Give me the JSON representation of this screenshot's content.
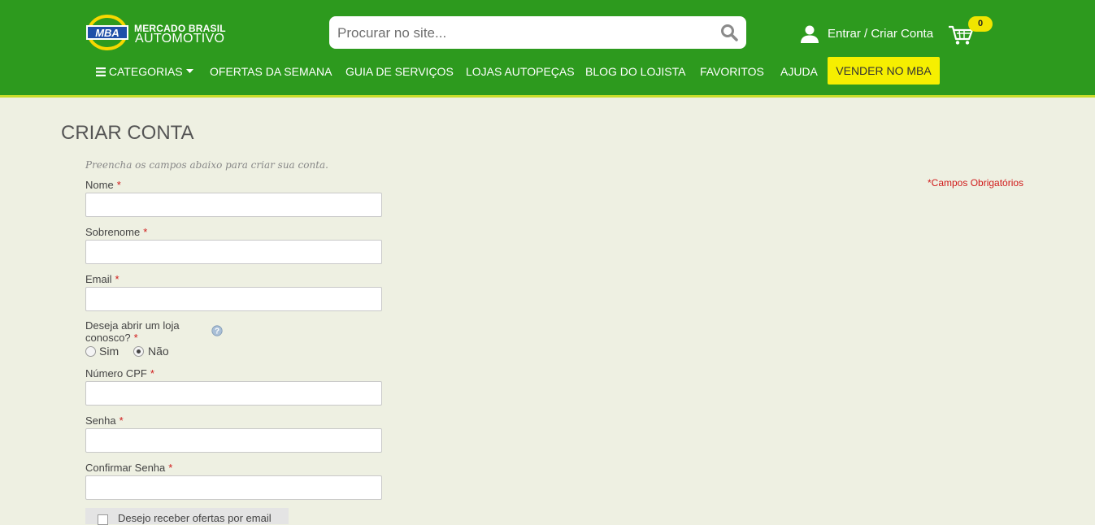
{
  "header": {
    "logo": {
      "line1": "MERCADO BRASIL",
      "line2": "AUTOMOTIVO",
      "badge_text": "MBA"
    },
    "search": {
      "placeholder": "Procurar no site...",
      "value": "",
      "icon": "search-icon"
    },
    "account": {
      "label": "Entrar / Criar Conta",
      "icon": "user-icon"
    },
    "cart": {
      "count": "0",
      "icon": "cart-icon"
    },
    "colors": {
      "bar": "#2d9a1e",
      "accent": "#f6ef00"
    }
  },
  "nav": {
    "categories": "CATEGORIAS",
    "items": [
      "OFERTAS DA SEMANA",
      "GUIA DE SERVIÇOS",
      "LOJAS AUTOPEÇAS",
      "BLOG DO LOJISTA",
      "FAVORITOS",
      "AJUDA"
    ],
    "cta": "VENDER NO MBA"
  },
  "page": {
    "title": "CRIAR CONTA",
    "intro": "Preencha os campos abaixo para criar sua conta.",
    "required_note": "*Campos Obrigatórios"
  },
  "form": {
    "required_mark": "*",
    "fields": [
      {
        "label": "Nome",
        "value": ""
      },
      {
        "label": "Sobrenome",
        "value": ""
      },
      {
        "label": "Email",
        "value": ""
      },
      {
        "label": "Número CPF",
        "value": ""
      },
      {
        "label": "Senha",
        "value": ""
      },
      {
        "label": "Confirmar Senha",
        "value": ""
      }
    ],
    "store_question": "Deseja abrir um loja conosco?",
    "store_options": [
      {
        "label": "Sim",
        "checked": false
      },
      {
        "label": "Não",
        "checked": true
      }
    ],
    "newsletter_label": "Desejo receber ofertas por email"
  }
}
